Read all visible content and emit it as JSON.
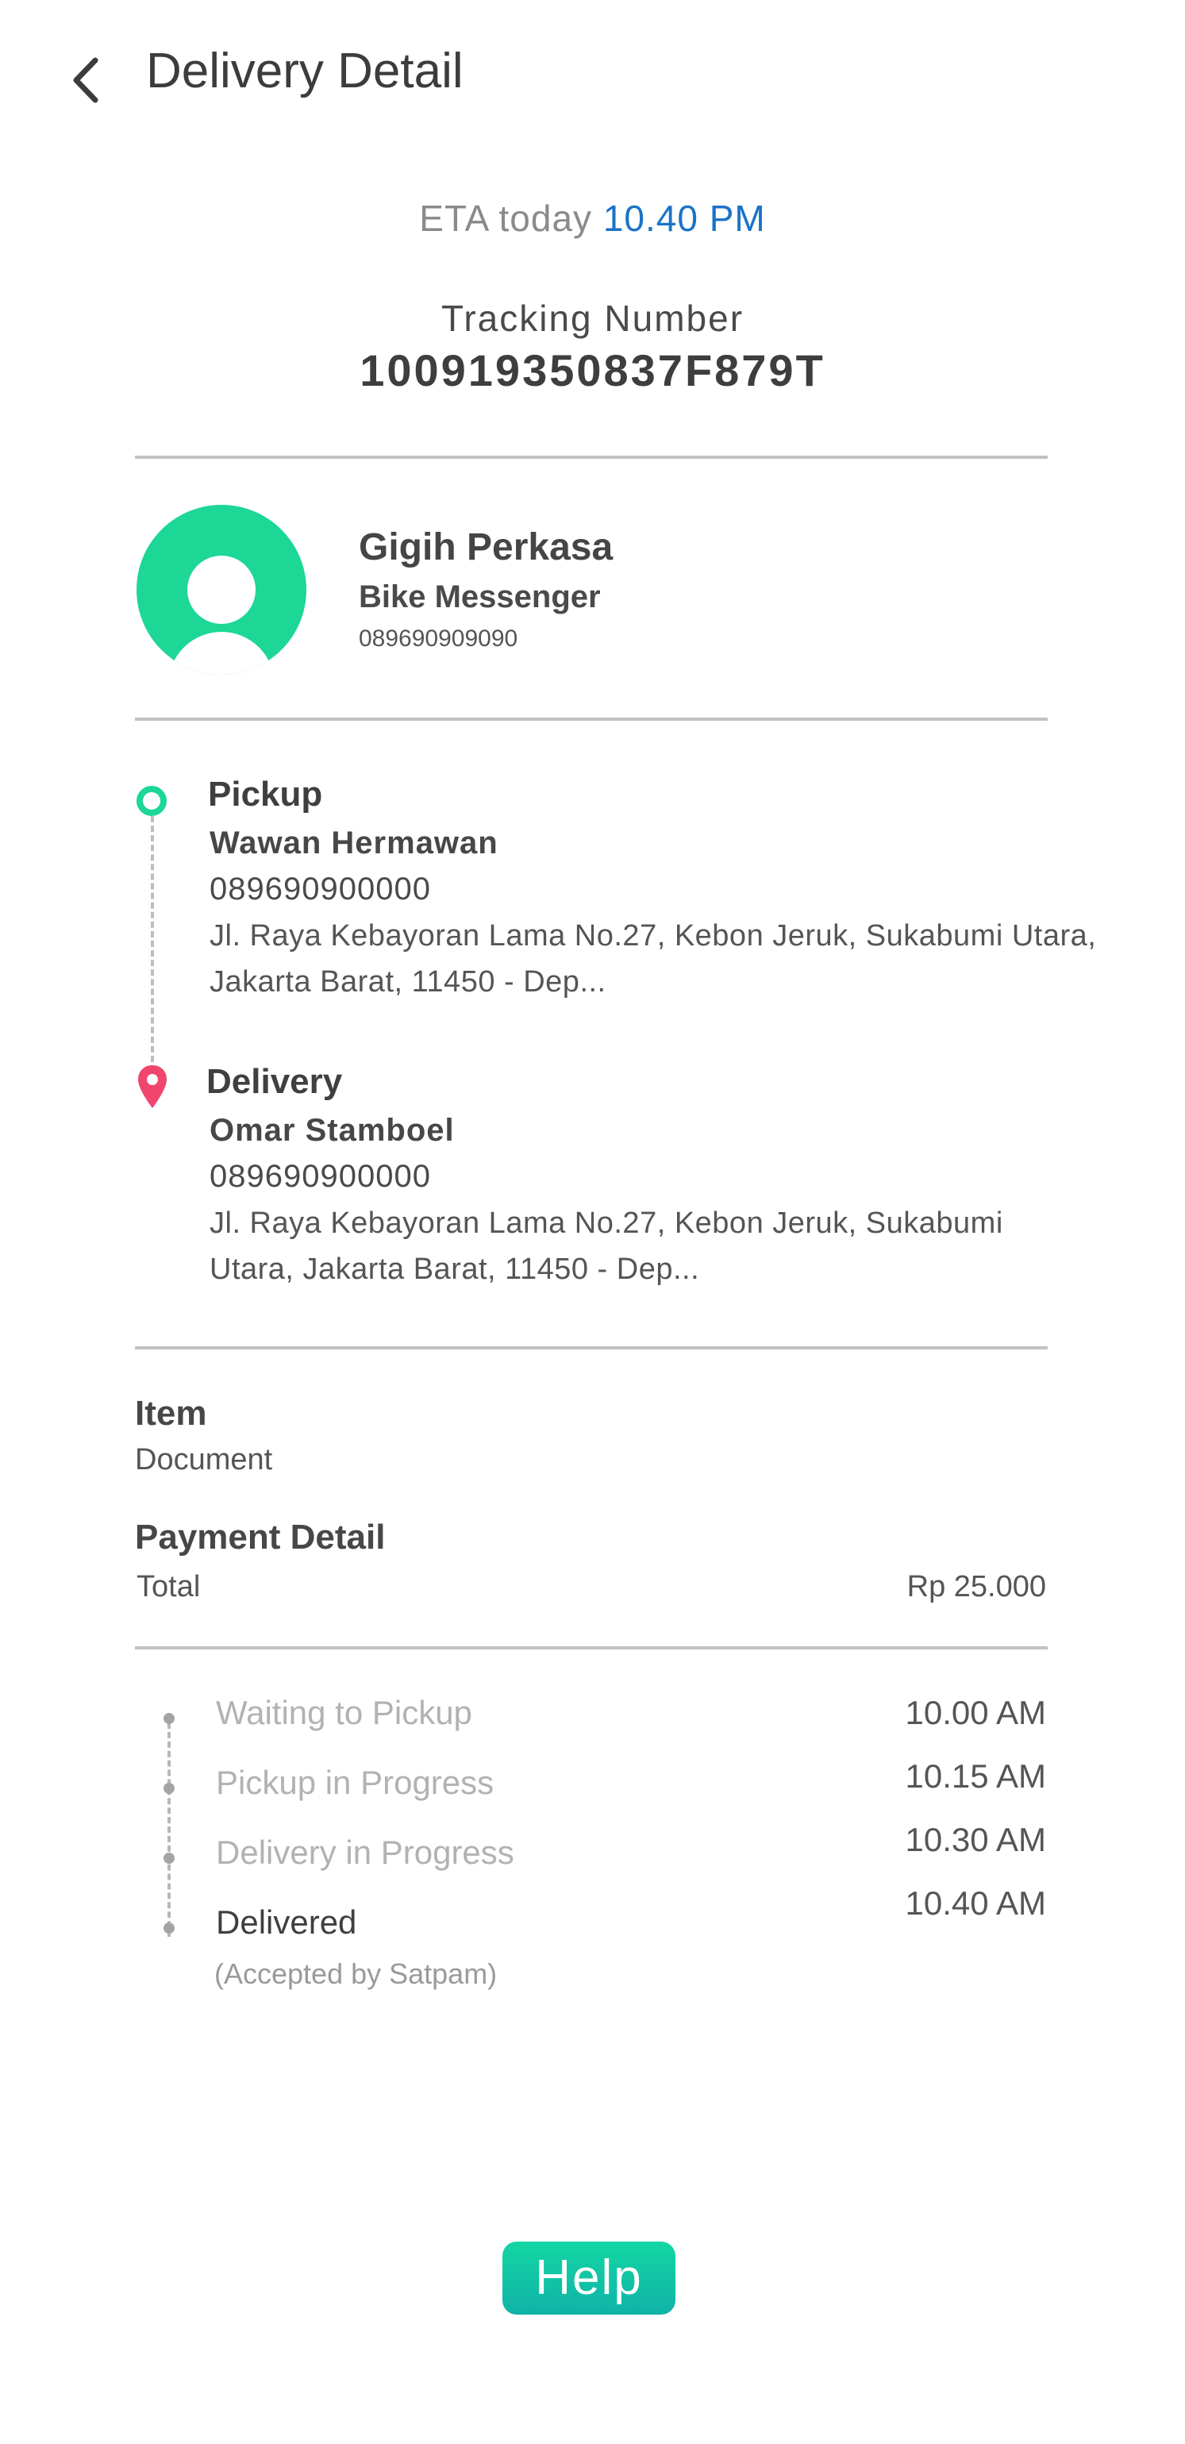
{
  "header": {
    "title": "Delivery Detail",
    "back_icon": "chevron-left-icon"
  },
  "eta": {
    "prefix": "ETA today",
    "time": "10.40 PM"
  },
  "tracking": {
    "label": "Tracking Number",
    "number": "100919350837F879T"
  },
  "courier": {
    "name": "Gigih Perkasa",
    "role": "Bike Messenger",
    "phone": "089690909090",
    "avatar_color": "#1cd796"
  },
  "route": {
    "pickup": {
      "label": "Pickup",
      "name": "Wawan Hermawan",
      "phone": "089690900000",
      "address": "Jl. Raya Kebayoran Lama No.27, Kebon Jeruk, Sukabumi Utara, Jakarta Barat, 11450 - Dep..."
    },
    "delivery": {
      "label": "Delivery",
      "name": "Omar Stamboel",
      "phone": "089690900000",
      "address": "Jl. Raya Kebayoran Lama No.27, Kebon Jeruk, Sukabumi Utara, Jakarta Barat, 11450 - Dep..."
    }
  },
  "item": {
    "title": "Item",
    "value": "Document"
  },
  "payment": {
    "title": "Payment Detail",
    "total_label": "Total",
    "total_value": "Rp 25.000"
  },
  "status": [
    {
      "label": "Waiting to Pickup",
      "time": "10.00 AM"
    },
    {
      "label": "Pickup in Progress",
      "time": "10.15 AM"
    },
    {
      "label": "Delivery in Progress",
      "time": "10.30 AM"
    },
    {
      "label": "Delivered",
      "time": "10.40 AM",
      "note": "(Accepted by Satpam)"
    }
  ],
  "help_label": "Help",
  "colors": {
    "accent_green": "#1cd796",
    "eta_blue": "#1a73c8",
    "pin_red": "#f0466e"
  }
}
